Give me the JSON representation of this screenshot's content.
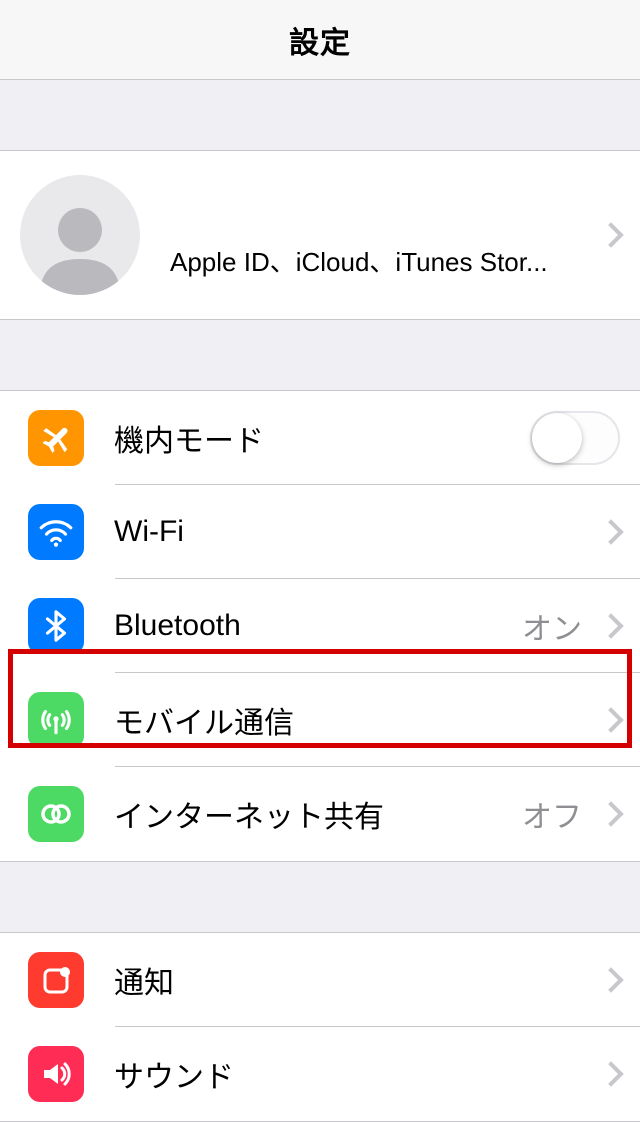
{
  "header": {
    "title": "設定"
  },
  "appleId": {
    "subtitle": "Apple ID、iCloud、iTunes Stor..."
  },
  "group1": {
    "airplane": {
      "label": "機内モード",
      "on": false
    },
    "wifi": {
      "label": "Wi-Fi",
      "value": ""
    },
    "bluetooth": {
      "label": "Bluetooth",
      "value": "オン"
    },
    "cellular": {
      "label": "モバイル通信"
    },
    "hotspot": {
      "label": "インターネット共有",
      "value": "オフ"
    }
  },
  "group2": {
    "notifications": {
      "label": "通知"
    },
    "sound": {
      "label": "サウンド"
    }
  }
}
